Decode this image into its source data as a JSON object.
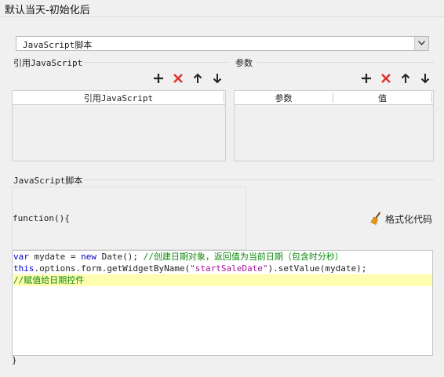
{
  "window": {
    "title": "默认当天-初始化后"
  },
  "type_select": {
    "value": "JavaScript脚本"
  },
  "ref_section": {
    "label": "引用JavaScript",
    "header": "引用JavaScript",
    "rows": []
  },
  "param_section": {
    "label": "参数",
    "headers": [
      "参数",
      "值"
    ],
    "rows": []
  },
  "toolbar": {
    "icons": [
      "add-icon",
      "delete-icon",
      "move-up-icon",
      "move-down-icon"
    ],
    "colors": {
      "add": "#222222",
      "delete": "#e0302a",
      "arrow": "#222222"
    }
  },
  "script_section": {
    "label": "JavaScript脚本",
    "function_header": "function(){",
    "closing": "}",
    "format_button": "格式化代码"
  },
  "code": {
    "line1": {
      "kw1": "var",
      "t1": " mydate = ",
      "kw2": "new",
      "t2": " Date(); ",
      "comment": "//创建日期对象，返回值为当前日期（包含时分秒）"
    },
    "line2": {
      "kw": "this",
      "t1": ".options.form.getWidgetByName(",
      "str": "\"startSaleDate\"",
      "t2": ").setValue(mydate);"
    },
    "line3": {
      "comment": "//赋值给日期控件"
    },
    "colors": {
      "keyword": "#0000cc",
      "string": "#a0149a",
      "comment": "#108a10",
      "highlight": "#fefdb0"
    }
  }
}
